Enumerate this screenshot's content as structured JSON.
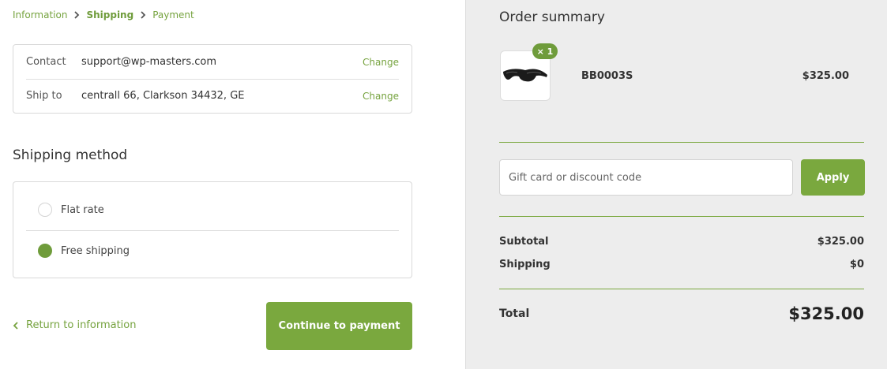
{
  "breadcrumb": {
    "items": [
      "Information",
      "Shipping",
      "Payment"
    ]
  },
  "contact": {
    "label": "Contact",
    "value": "support@wp-masters.com",
    "change": "Change"
  },
  "ship_to": {
    "label": "Ship to",
    "value": "centrall 66, Clarkson 34432, GE",
    "change": "Change"
  },
  "shipping_method": {
    "title": "Shipping method",
    "options": [
      {
        "label": "Flat rate",
        "selected": false
      },
      {
        "label": "Free shipping",
        "selected": true
      }
    ]
  },
  "actions": {
    "return_label": "Return to information",
    "continue_label": "Continue to payment"
  },
  "summary": {
    "title": "Order summary",
    "product": {
      "name": "BB0003S",
      "price": "$325.00",
      "quantity": "× 1",
      "image_icon": "sunglasses-icon"
    },
    "discount": {
      "placeholder": "Gift card or discount code",
      "apply_label": "Apply"
    },
    "subtotal_label": "Subtotal",
    "subtotal_value": "$325.00",
    "shipping_label": "Shipping",
    "shipping_value": "$0",
    "total_label": "Total",
    "total_value": "$325.00"
  },
  "colors": {
    "accent": "#7aa83e",
    "summary_bg": "#ededed"
  }
}
